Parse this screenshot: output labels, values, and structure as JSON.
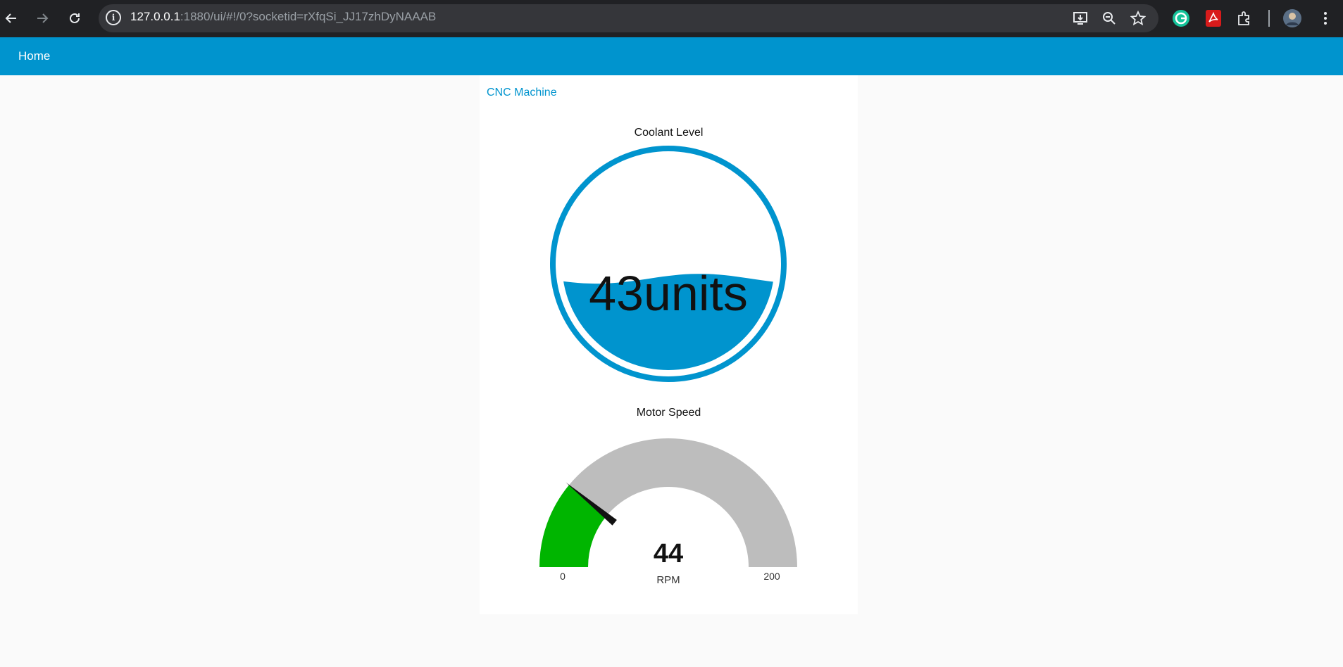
{
  "browser": {
    "url_host": "127.0.0.1",
    "url_path": ":1880/ui/#!/0?socketid=rXfqSi_JJ17zhDyNAAAB",
    "icons": [
      "back-icon",
      "forward-icon",
      "reload-icon",
      "site-info-icon",
      "install-app-icon",
      "zoom-icon",
      "bookmark-star-icon",
      "grammarly-icon",
      "acrobat-icon",
      "extensions-icon",
      "profile-avatar",
      "menu-icon"
    ]
  },
  "toolbar": {
    "title": "Home"
  },
  "group": {
    "title": "CNC Machine"
  },
  "coolant": {
    "title": "Coolant Level",
    "value": 43,
    "unit": "units",
    "display": "43units",
    "fill_fraction": 0.43,
    "colors": {
      "ring": "#0094ce",
      "liquid": "#0094ce"
    }
  },
  "motor": {
    "title": "Motor Speed",
    "value": "44",
    "unit": "RPM",
    "min": "0",
    "max": "200",
    "value_num": 44,
    "min_num": 0,
    "max_num": 200,
    "colors": {
      "fill": "#00b500",
      "track": "#bdbdbd",
      "needle": "#111111"
    }
  }
}
